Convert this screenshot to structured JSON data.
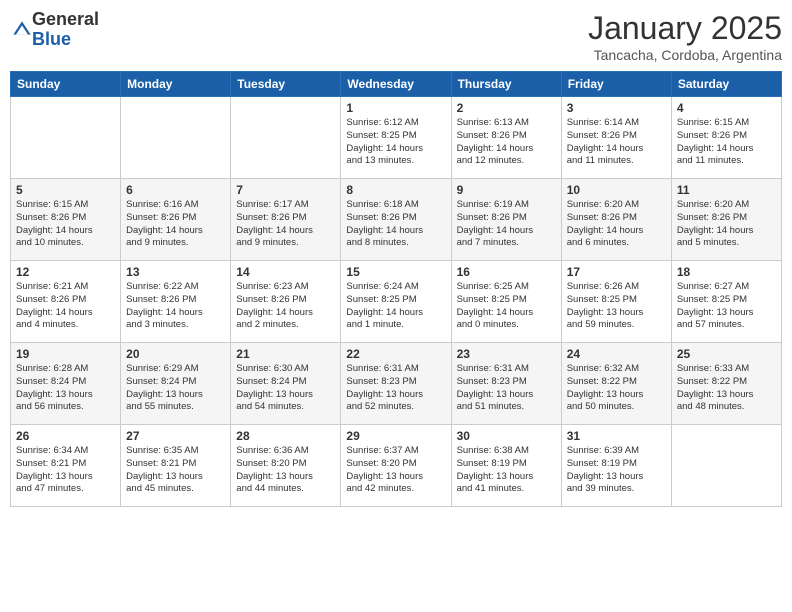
{
  "logo": {
    "general": "General",
    "blue": "Blue"
  },
  "title": "January 2025",
  "subtitle": "Tancacha, Cordoba, Argentina",
  "days_of_week": [
    "Sunday",
    "Monday",
    "Tuesday",
    "Wednesday",
    "Thursday",
    "Friday",
    "Saturday"
  ],
  "weeks": [
    [
      {
        "day": "",
        "info": ""
      },
      {
        "day": "",
        "info": ""
      },
      {
        "day": "",
        "info": ""
      },
      {
        "day": "1",
        "info": "Sunrise: 6:12 AM\nSunset: 8:25 PM\nDaylight: 14 hours\nand 13 minutes."
      },
      {
        "day": "2",
        "info": "Sunrise: 6:13 AM\nSunset: 8:26 PM\nDaylight: 14 hours\nand 12 minutes."
      },
      {
        "day": "3",
        "info": "Sunrise: 6:14 AM\nSunset: 8:26 PM\nDaylight: 14 hours\nand 11 minutes."
      },
      {
        "day": "4",
        "info": "Sunrise: 6:15 AM\nSunset: 8:26 PM\nDaylight: 14 hours\nand 11 minutes."
      }
    ],
    [
      {
        "day": "5",
        "info": "Sunrise: 6:15 AM\nSunset: 8:26 PM\nDaylight: 14 hours\nand 10 minutes."
      },
      {
        "day": "6",
        "info": "Sunrise: 6:16 AM\nSunset: 8:26 PM\nDaylight: 14 hours\nand 9 minutes."
      },
      {
        "day": "7",
        "info": "Sunrise: 6:17 AM\nSunset: 8:26 PM\nDaylight: 14 hours\nand 9 minutes."
      },
      {
        "day": "8",
        "info": "Sunrise: 6:18 AM\nSunset: 8:26 PM\nDaylight: 14 hours\nand 8 minutes."
      },
      {
        "day": "9",
        "info": "Sunrise: 6:19 AM\nSunset: 8:26 PM\nDaylight: 14 hours\nand 7 minutes."
      },
      {
        "day": "10",
        "info": "Sunrise: 6:20 AM\nSunset: 8:26 PM\nDaylight: 14 hours\nand 6 minutes."
      },
      {
        "day": "11",
        "info": "Sunrise: 6:20 AM\nSunset: 8:26 PM\nDaylight: 14 hours\nand 5 minutes."
      }
    ],
    [
      {
        "day": "12",
        "info": "Sunrise: 6:21 AM\nSunset: 8:26 PM\nDaylight: 14 hours\nand 4 minutes."
      },
      {
        "day": "13",
        "info": "Sunrise: 6:22 AM\nSunset: 8:26 PM\nDaylight: 14 hours\nand 3 minutes."
      },
      {
        "day": "14",
        "info": "Sunrise: 6:23 AM\nSunset: 8:26 PM\nDaylight: 14 hours\nand 2 minutes."
      },
      {
        "day": "15",
        "info": "Sunrise: 6:24 AM\nSunset: 8:25 PM\nDaylight: 14 hours\nand 1 minute."
      },
      {
        "day": "16",
        "info": "Sunrise: 6:25 AM\nSunset: 8:25 PM\nDaylight: 14 hours\nand 0 minutes."
      },
      {
        "day": "17",
        "info": "Sunrise: 6:26 AM\nSunset: 8:25 PM\nDaylight: 13 hours\nand 59 minutes."
      },
      {
        "day": "18",
        "info": "Sunrise: 6:27 AM\nSunset: 8:25 PM\nDaylight: 13 hours\nand 57 minutes."
      }
    ],
    [
      {
        "day": "19",
        "info": "Sunrise: 6:28 AM\nSunset: 8:24 PM\nDaylight: 13 hours\nand 56 minutes."
      },
      {
        "day": "20",
        "info": "Sunrise: 6:29 AM\nSunset: 8:24 PM\nDaylight: 13 hours\nand 55 minutes."
      },
      {
        "day": "21",
        "info": "Sunrise: 6:30 AM\nSunset: 8:24 PM\nDaylight: 13 hours\nand 54 minutes."
      },
      {
        "day": "22",
        "info": "Sunrise: 6:31 AM\nSunset: 8:23 PM\nDaylight: 13 hours\nand 52 minutes."
      },
      {
        "day": "23",
        "info": "Sunrise: 6:31 AM\nSunset: 8:23 PM\nDaylight: 13 hours\nand 51 minutes."
      },
      {
        "day": "24",
        "info": "Sunrise: 6:32 AM\nSunset: 8:22 PM\nDaylight: 13 hours\nand 50 minutes."
      },
      {
        "day": "25",
        "info": "Sunrise: 6:33 AM\nSunset: 8:22 PM\nDaylight: 13 hours\nand 48 minutes."
      }
    ],
    [
      {
        "day": "26",
        "info": "Sunrise: 6:34 AM\nSunset: 8:21 PM\nDaylight: 13 hours\nand 47 minutes."
      },
      {
        "day": "27",
        "info": "Sunrise: 6:35 AM\nSunset: 8:21 PM\nDaylight: 13 hours\nand 45 minutes."
      },
      {
        "day": "28",
        "info": "Sunrise: 6:36 AM\nSunset: 8:20 PM\nDaylight: 13 hours\nand 44 minutes."
      },
      {
        "day": "29",
        "info": "Sunrise: 6:37 AM\nSunset: 8:20 PM\nDaylight: 13 hours\nand 42 minutes."
      },
      {
        "day": "30",
        "info": "Sunrise: 6:38 AM\nSunset: 8:19 PM\nDaylight: 13 hours\nand 41 minutes."
      },
      {
        "day": "31",
        "info": "Sunrise: 6:39 AM\nSunset: 8:19 PM\nDaylight: 13 hours\nand 39 minutes."
      },
      {
        "day": "",
        "info": ""
      }
    ]
  ]
}
